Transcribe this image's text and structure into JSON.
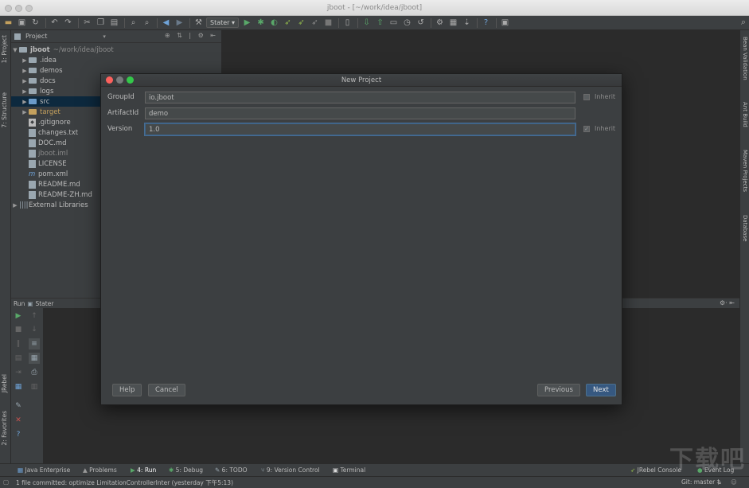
{
  "window": {
    "title": "jboot - [~/work/idea/jboot]"
  },
  "toolbar": {
    "run_config": "Stater ▾"
  },
  "left_stripe": {
    "project_tab": "1: Project",
    "structure_tab": "7: Structure",
    "jrebel_tab": "JRebel",
    "favorites_tab": "2: Favorites"
  },
  "right_stripe": {
    "bean_validation": "Bean Validation",
    "ant_build": "Ant Build",
    "maven_projects": "Maven Projects",
    "database": "Database"
  },
  "project_panel": {
    "header": "Project",
    "root_name": "jboot",
    "root_path": "~/work/idea/jboot",
    "items": [
      {
        "label": ".idea"
      },
      {
        "label": "demos"
      },
      {
        "label": "docs"
      },
      {
        "label": "logs"
      },
      {
        "label": "src"
      },
      {
        "label": "target"
      },
      {
        "label": ".gitignore"
      },
      {
        "label": "changes.txt"
      },
      {
        "label": "DOC.md"
      },
      {
        "label": "jboot.iml"
      },
      {
        "label": "LICENSE"
      },
      {
        "label": "pom.xml"
      },
      {
        "label": "README.md"
      },
      {
        "label": "README-ZH.md"
      }
    ],
    "external_libraries": "External Libraries"
  },
  "run_panel": {
    "header_prefix": "Run",
    "header_config": "Stater"
  },
  "dialog": {
    "title": "New Project",
    "groupid_label": "GroupId",
    "groupid_value": "io.jboot",
    "artifactid_label": "ArtifactId",
    "artifactid_value": "demo",
    "version_label": "Version",
    "version_value": "1.0",
    "inherit_label": "Inherit",
    "help_button": "Help",
    "cancel_button": "Cancel",
    "previous_button": "Previous",
    "next_button": "Next"
  },
  "bottom_tabs": {
    "java_enterprise": "Java Enterprise",
    "problems": "Problems",
    "run": "4: Run",
    "debug": "5: Debug",
    "todo": "6: TODO",
    "version_control": "9: Version Control",
    "terminal": "Terminal",
    "jrebel_console": "JRebel Console",
    "event_log": "Event Log"
  },
  "statusbar": {
    "message": "1 file committed: optimize LimitationControllerInter (yesterday 下午5:13)",
    "git_branch": "Git: master ‡"
  },
  "watermark": "下载吧",
  "colors": {
    "background": "#2b2b2b",
    "panel": "#3c3f41",
    "selection": "#0d293e",
    "accent_button": "#365880",
    "focus_ring": "#466d94"
  }
}
